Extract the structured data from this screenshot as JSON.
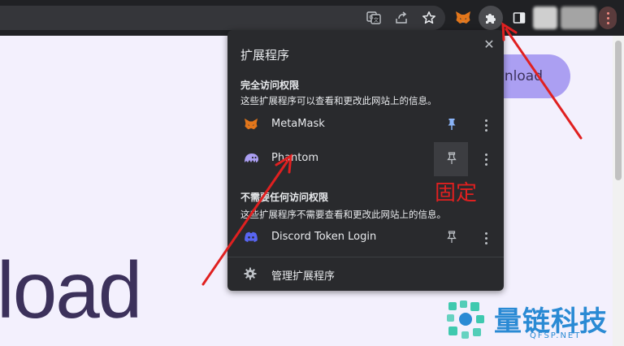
{
  "page": {
    "download_button": "Download",
    "hero_text": "load"
  },
  "toolbar": {
    "icons": [
      "translate-icon",
      "share-icon",
      "bookmark-star-icon",
      "metamask-icon",
      "extensions-puzzle-icon",
      "side-panel-icon",
      "profile-avatar",
      "chrome-menu-icon"
    ]
  },
  "popup": {
    "title": "扩展程序",
    "full_access": {
      "heading": "完全访问权限",
      "description": "这些扩展程序可以查看和更改此网站上的信息。",
      "items": [
        {
          "name": "MetaMask",
          "pinned": true
        },
        {
          "name": "Phantom",
          "pinned": false
        }
      ]
    },
    "no_access": {
      "heading": "不需要任何访问权限",
      "description": "这些扩展程序不需要查看和更改此网站上的信息。",
      "items": [
        {
          "name": "Discord Token Login",
          "pinned": false
        }
      ]
    },
    "manage_label": "管理扩展程序"
  },
  "annotation": {
    "label": "固定",
    "color": "#e02020"
  },
  "watermark": {
    "brand": "量链科技",
    "domain": "QFSP.NET"
  },
  "colors": {
    "toolbar_bg": "#202124",
    "popup_bg": "#292a2d",
    "accent_purple": "#ab9ff2",
    "pin_active": "#8ab4f8",
    "annotation_red": "#e02020",
    "watermark_blue": "#2a8ad4"
  }
}
